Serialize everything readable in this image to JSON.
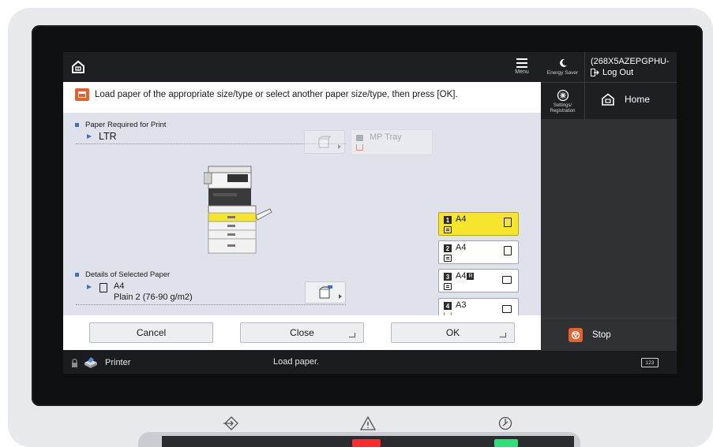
{
  "topbar": {
    "menu_label": "Menu"
  },
  "message": {
    "text": "Load paper of the appropriate size/type or select another paper size/type, then press [OK]."
  },
  "paper_required": {
    "label": "Paper Required for Print",
    "value": "LTR"
  },
  "mp_tray": {
    "label": "MP Tray"
  },
  "trays": [
    {
      "num": "1",
      "size": "A4",
      "selected": true
    },
    {
      "num": "2",
      "size": "A4",
      "selected": false
    },
    {
      "num": "3",
      "size": "A4",
      "badge": "R",
      "selected": false
    },
    {
      "num": "4",
      "size": "A3",
      "selected": false
    }
  ],
  "selected_paper": {
    "label": "Details of Selected Paper",
    "size": "A4",
    "type": "Plain 2 (76-90 g/m2)"
  },
  "actions": {
    "cancel": "Cancel",
    "close": "Close",
    "ok": "OK"
  },
  "status": {
    "mode": "Printer",
    "message": "Load paper."
  },
  "right_panel": {
    "energy_label": "Energy Saver",
    "user_id": "(268X5AZEPGPHU-",
    "logout": "Log Out",
    "settings_label_1": "Settings/",
    "settings_label_2": "Registration",
    "home": "Home",
    "stop": "Stop",
    "keyboard": "123"
  },
  "colors": {
    "accent_blue": "#3d71c9",
    "selected_tray": "#f5e52c",
    "warning_orange": "#e8602c",
    "led_red": "#ff2a2a",
    "led_green": "#2fe07a"
  }
}
